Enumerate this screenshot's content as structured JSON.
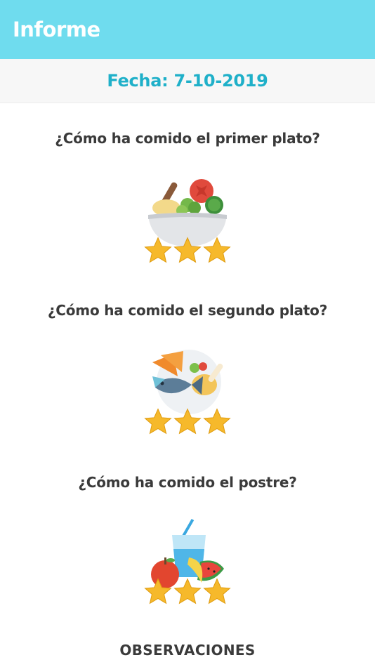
{
  "appbar": {
    "title": "Informe"
  },
  "date": {
    "label": "Fecha: 7-10-2019"
  },
  "questions": [
    {
      "text": "¿Cómo ha comido el primer plato?",
      "icon": "salad-bowl-icon",
      "rating": 3,
      "max_rating": 3
    },
    {
      "text": "¿Cómo ha comido el segundo plato?",
      "icon": "fish-chicken-plate-icon",
      "rating": 3,
      "max_rating": 3
    },
    {
      "text": "¿Cómo ha comido el postre?",
      "icon": "fruit-juice-icon",
      "rating": 3,
      "max_rating": 3
    }
  ],
  "observations": {
    "label": "OBSERVACIONES"
  },
  "colors": {
    "appbar": "#6fdcee",
    "date_text": "#1fb0c9",
    "star": "#f6b92b"
  }
}
